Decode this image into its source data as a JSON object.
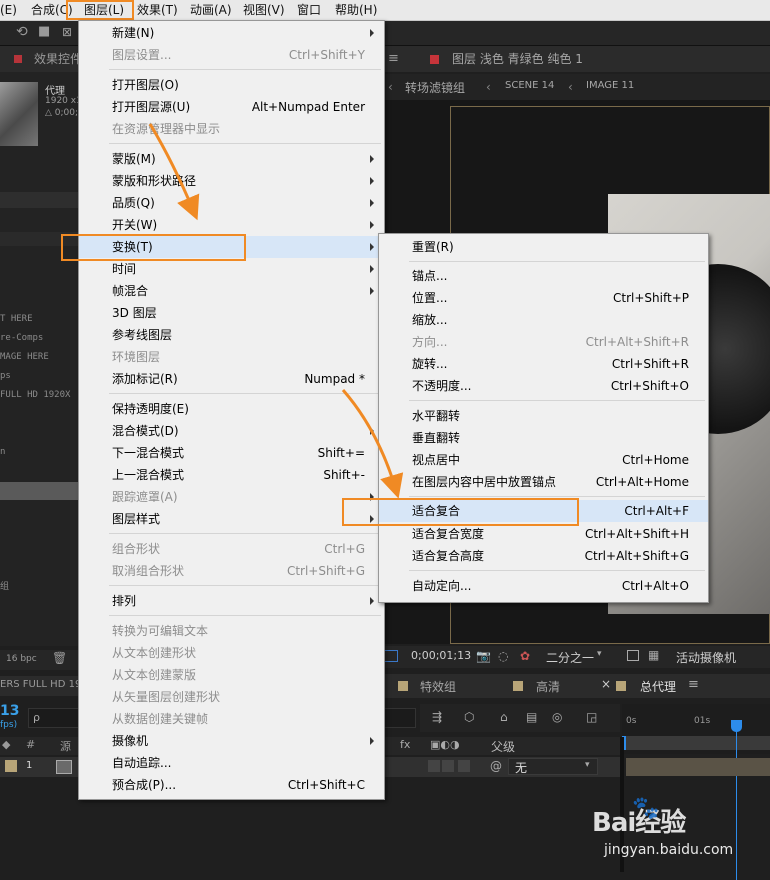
{
  "menubar": {
    "items": [
      "(E)",
      "合成(C)",
      "图层(L)",
      "效果(T)",
      "动画(A)",
      "视图(V)",
      "窗口",
      "帮助(H)"
    ]
  },
  "left_panel": {
    "tab_label": "效果控件",
    "proxy_label": "代理",
    "proxy_size": "1920 x1",
    "proxy_time": "△ 0;00;",
    "project_rows": [
      "T HERE",
      "re-Comps",
      "MAGE HERE",
      "ps",
      "FULL HD 1920X",
      "n",
      "组"
    ],
    "bpc": "16 bpc",
    "comp_name": "ERS FULL HD 19",
    "current_frame": "13",
    "fps": "fps)",
    "source_header": "源"
  },
  "viewer": {
    "comp_tab": "图层 浅色 青绿色 纯色 1",
    "breadcrumbs": [
      "转场滤镜组",
      "SCENE 14",
      "IMAGE 11"
    ],
    "timecode": "0;00;01;13",
    "resolution": "二分之一",
    "camera": "活动摄像机"
  },
  "timeline": {
    "tabs": [
      "特效组",
      "高清",
      "总代理"
    ],
    "search_placeholder": "ρ",
    "ruler": [
      "0s",
      "01s"
    ],
    "parent_header": "父级",
    "layer_number": "1",
    "parent_value": "无"
  },
  "layer_menu": {
    "items": [
      {
        "label": "新建(N)",
        "shortcut": "",
        "submenu": true,
        "disabled": false
      },
      {
        "label": "图层设置...",
        "shortcut": "Ctrl+Shift+Y",
        "submenu": false,
        "disabled": true
      },
      {
        "label": "打开图层(O)",
        "shortcut": "",
        "submenu": false,
        "disabled": false
      },
      {
        "label": "打开图层源(U)",
        "shortcut": "Alt+Numpad Enter",
        "submenu": false,
        "disabled": false
      },
      {
        "label": "在资源管理器中显示",
        "shortcut": "",
        "submenu": false,
        "disabled": true
      },
      {
        "label": "蒙版(M)",
        "shortcut": "",
        "submenu": true,
        "disabled": false
      },
      {
        "label": "蒙版和形状路径",
        "shortcut": "",
        "submenu": true,
        "disabled": false
      },
      {
        "label": "品质(Q)",
        "shortcut": "",
        "submenu": true,
        "disabled": false
      },
      {
        "label": "开关(W)",
        "shortcut": "",
        "submenu": true,
        "disabled": false
      },
      {
        "label": "变换(T)",
        "shortcut": "",
        "submenu": true,
        "disabled": false
      },
      {
        "label": "时间",
        "shortcut": "",
        "submenu": true,
        "disabled": false
      },
      {
        "label": "帧混合",
        "shortcut": "",
        "submenu": true,
        "disabled": false
      },
      {
        "label": "3D 图层",
        "shortcut": "",
        "submenu": false,
        "disabled": false
      },
      {
        "label": "参考线图层",
        "shortcut": "",
        "submenu": false,
        "disabled": false
      },
      {
        "label": "环境图层",
        "shortcut": "",
        "submenu": false,
        "disabled": true
      },
      {
        "label": "添加标记(R)",
        "shortcut": "Numpad *",
        "submenu": false,
        "disabled": false
      },
      {
        "label": "保持透明度(E)",
        "shortcut": "",
        "submenu": false,
        "disabled": false
      },
      {
        "label": "混合模式(D)",
        "shortcut": "",
        "submenu": true,
        "disabled": false
      },
      {
        "label": "下一混合模式",
        "shortcut": "Shift+=",
        "submenu": false,
        "disabled": false
      },
      {
        "label": "上一混合模式",
        "shortcut": "Shift+-",
        "submenu": false,
        "disabled": false
      },
      {
        "label": "跟踪遮罩(A)",
        "shortcut": "",
        "submenu": true,
        "disabled": true
      },
      {
        "label": "图层样式",
        "shortcut": "",
        "submenu": true,
        "disabled": false
      },
      {
        "label": "组合形状",
        "shortcut": "Ctrl+G",
        "submenu": false,
        "disabled": true
      },
      {
        "label": "取消组合形状",
        "shortcut": "Ctrl+Shift+G",
        "submenu": false,
        "disabled": true
      },
      {
        "label": "排列",
        "shortcut": "",
        "submenu": true,
        "disabled": false
      },
      {
        "label": "转换为可编辑文本",
        "shortcut": "",
        "submenu": false,
        "disabled": true
      },
      {
        "label": "从文本创建形状",
        "shortcut": "",
        "submenu": false,
        "disabled": true
      },
      {
        "label": "从文本创建蒙版",
        "shortcut": "",
        "submenu": false,
        "disabled": true
      },
      {
        "label": "从矢量图层创建形状",
        "shortcut": "",
        "submenu": false,
        "disabled": true
      },
      {
        "label": "从数据创建关键帧",
        "shortcut": "",
        "submenu": false,
        "disabled": true
      },
      {
        "label": "摄像机",
        "shortcut": "",
        "submenu": true,
        "disabled": false
      },
      {
        "label": "自动追踪...",
        "shortcut": "",
        "submenu": false,
        "disabled": false
      },
      {
        "label": "预合成(P)...",
        "shortcut": "Ctrl+Shift+C",
        "submenu": false,
        "disabled": false
      }
    ]
  },
  "transform_menu": {
    "items": [
      {
        "label": "重置(R)",
        "shortcut": "",
        "disabled": false
      },
      {
        "label": "锚点...",
        "shortcut": "",
        "disabled": false
      },
      {
        "label": "位置...",
        "shortcut": "Ctrl+Shift+P",
        "disabled": false
      },
      {
        "label": "缩放...",
        "shortcut": "",
        "disabled": false
      },
      {
        "label": "方向...",
        "shortcut": "Ctrl+Alt+Shift+R",
        "disabled": true
      },
      {
        "label": "旋转...",
        "shortcut": "Ctrl+Shift+R",
        "disabled": false
      },
      {
        "label": "不透明度...",
        "shortcut": "Ctrl+Shift+O",
        "disabled": false
      },
      {
        "label": "水平翻转",
        "shortcut": "",
        "disabled": false
      },
      {
        "label": "垂直翻转",
        "shortcut": "",
        "disabled": false
      },
      {
        "label": "视点居中",
        "shortcut": "Ctrl+Home",
        "disabled": false
      },
      {
        "label": "在图层内容中居中放置锚点",
        "shortcut": "Ctrl+Alt+Home",
        "disabled": false
      },
      {
        "label": "适合复合",
        "shortcut": "Ctrl+Alt+F",
        "disabled": false
      },
      {
        "label": "适合复合宽度",
        "shortcut": "Ctrl+Alt+Shift+H",
        "disabled": false
      },
      {
        "label": "适合复合高度",
        "shortcut": "Ctrl+Alt+Shift+G",
        "disabled": false
      },
      {
        "label": "自动定向...",
        "shortcut": "Ctrl+Alt+O",
        "disabled": false
      }
    ]
  },
  "colors": {
    "annotation": "#f08a24",
    "highlight": "#d7e6f7",
    "playhead": "#2d8ceb"
  },
  "watermark": {
    "brand": "Bai经验",
    "url": "jingyan.baidu.com"
  }
}
